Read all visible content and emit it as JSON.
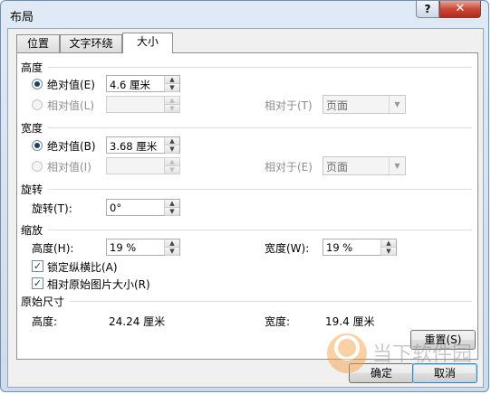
{
  "window": {
    "title": "布局",
    "help_glyph": "?",
    "close_glyph": "✕"
  },
  "tabs": [
    {
      "label": "位置"
    },
    {
      "label": "文字环绕"
    },
    {
      "label": "大小"
    }
  ],
  "height_section": {
    "title": "高度",
    "absolute_label": "绝对值(E)",
    "absolute_value": "4.6 厘米",
    "relative_label": "相对值(L)",
    "relative_to_label": "相对于(T)",
    "relative_to_value": "页面"
  },
  "width_section": {
    "title": "宽度",
    "absolute_label": "绝对值(B)",
    "absolute_value": "3.68 厘米",
    "relative_label": "相对值(I)",
    "relative_to_label": "相对于(E)",
    "relative_to_value": "页面"
  },
  "rotate_section": {
    "title": "旋转",
    "rotation_label": "旋转(T):",
    "rotation_value": "0°"
  },
  "scale_section": {
    "title": "缩放",
    "height_label": "高度(H):",
    "height_value": "19 %",
    "width_label": "宽度(W):",
    "width_value": "19 %",
    "lock_ratio_label": "锁定纵横比(A)",
    "relative_original_label": "相对原始图片大小(R)"
  },
  "original_section": {
    "title": "原始尺寸",
    "height_label": "高度:",
    "height_value": "24.24 厘米",
    "width_label": "宽度:",
    "width_value": "19.4 厘米"
  },
  "buttons": {
    "reset": "重置(S)",
    "ok": "确定",
    "cancel": "取消"
  },
  "watermark": {
    "text": "当下软件园"
  },
  "glyphs": {
    "check": "✓",
    "up": "▲",
    "down": "▼",
    "dropdown": "▼"
  }
}
